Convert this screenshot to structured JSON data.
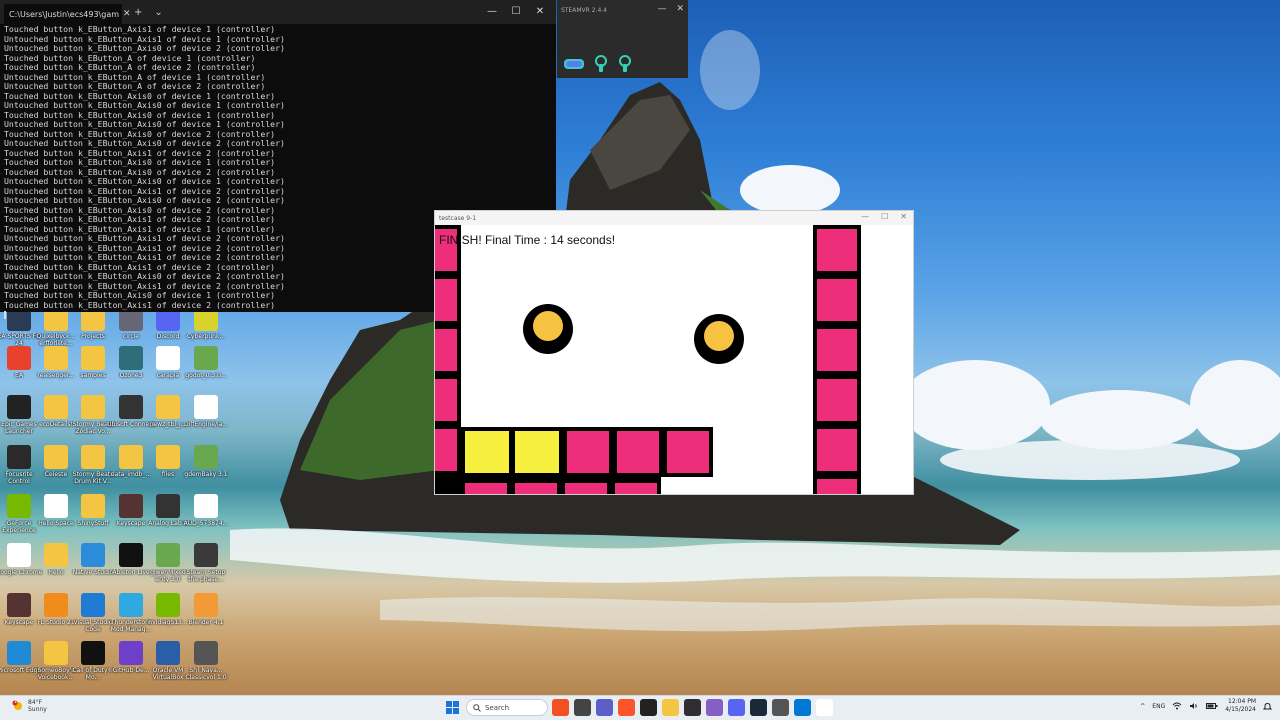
{
  "terminal": {
    "tab_title": "C:\\Users\\Justin\\ecs493\\gam",
    "new_tab_label": "+",
    "dropdown_label": "⌄",
    "minimize_label": "—",
    "maximize_label": "☐",
    "close_label": "✕",
    "lines": [
      "Touched button k_EButton_Axis1 of device 1 (controller)",
      "Untouched button k_EButton_Axis1 of device 1 (controller)",
      "Untouched button k_EButton_Axis0 of device 2 (controller)",
      "Touched button k_EButton_A of device 1 (controller)",
      "Touched button k_EButton_A of device 2 (controller)",
      "Untouched button k_EButton_A of device 1 (controller)",
      "Untouched button k_EButton_A of device 2 (controller)",
      "Touched button k_EButton_Axis0 of device 1 (controller)",
      "Untouched button k_EButton_Axis0 of device 1 (controller)",
      "Touched button k_EButton_Axis0 of device 1 (controller)",
      "Untouched button k_EButton_Axis0 of device 1 (controller)",
      "Touched button k_EButton_Axis0 of device 2 (controller)",
      "Untouched button k_EButton_Axis0 of device 2 (controller)",
      "Touched button k_EButton_Axis1 of device 2 (controller)",
      "Touched button k_EButton_Axis0 of device 1 (controller)",
      "Touched button k_EButton_Axis0 of device 2 (controller)",
      "Untouched button k_EButton_Axis0 of device 1 (controller)",
      "Untouched button k_EButton_Axis1 of device 2 (controller)",
      "Untouched button k_EButton_Axis0 of device 2 (controller)",
      "Touched button k_EButton_Axis0 of device 2 (controller)",
      "Touched button k_EButton_Axis1 of device 2 (controller)",
      "Touched button k_EButton_Axis1 of device 1 (controller)",
      "Untouched button k_EButton_Axis1 of device 2 (controller)",
      "Untouched button k_EButton_Axis1 of device 2 (controller)",
      "Untouched button k_EButton_Axis1 of device 2 (controller)",
      "Touched button k_EButton_Axis1 of device 2 (controller)",
      "Untouched button k_EButton_Axis0 of device 2 (controller)",
      "Untouched button k_EButton_Axis1 of device 2 (controller)",
      "Touched button k_EButton_Axis0 of device 1 (controller)",
      "Touched button k_EButton_Axis1 of device 2 (controller)"
    ]
  },
  "steamvr": {
    "title": "STEAMVR 2.4.4",
    "minimize_label": "—",
    "close_label": "✕"
  },
  "game": {
    "window_title": "testcase 9-1",
    "minimize_label": "—",
    "maximize_label": "☐",
    "close_label": "✕",
    "finish_text": "FINISH! Final Time : 14 seconds!"
  },
  "colors": {
    "block_pink": "#ee2e7a",
    "block_yellow": "#f6ef3e",
    "coin_gold": "#f5c242",
    "outline_black": "#000000"
  },
  "desktop_icons": [
    {
      "label": "EA SPORTS FC 24",
      "icon": "ea-sports-icon",
      "color": "#2b3a55"
    },
    {
      "label": "Quixelbyck... erfforlilte...",
      "icon": "folder-icon",
      "color": "#f4c542"
    },
    {
      "label": "Projects",
      "icon": "folder-icon",
      "color": "#f4c542"
    },
    {
      "label": "circle",
      "icon": "app-icon",
      "color": "#667"
    },
    {
      "label": "Discord",
      "icon": "discord-icon",
      "color": "#5865f2"
    },
    {
      "label": "Cyberpunk...",
      "icon": "cyberpunk-icon",
      "color": "#d8d22c"
    },
    {
      "label": "EA",
      "icon": "ea-icon",
      "color": "#e8422f"
    },
    {
      "label": "realsenger...",
      "icon": "folder-icon",
      "color": "#f4c542"
    },
    {
      "label": "samples",
      "icon": "folder-icon",
      "color": "#f4c542"
    },
    {
      "label": "Ozone3",
      "icon": "globe-icon",
      "color": "#2e6d7a"
    },
    {
      "label": "carapia",
      "icon": "media-icon",
      "color": "#ffffff"
    },
    {
      "label": "godot_0.3.0...",
      "icon": "godot-icon",
      "color": "#6aa84f"
    },
    {
      "label": "Epic Games Launcher",
      "icon": "epic-games-icon",
      "color": "#222222"
    },
    {
      "label": "ecoDetails!",
      "icon": "folder-icon",
      "color": "#f4c542"
    },
    {
      "label": "Stormy Beats Zodiac Vo...",
      "icon": "folder-icon",
      "color": "#f4c542"
    },
    {
      "label": "Ubisoft Connect",
      "icon": "ubisoft-icon",
      "color": "#333333"
    },
    {
      "label": "newz_tbl_j...",
      "icon": "zip-icon",
      "color": "#f4c542"
    },
    {
      "label": "DiffEngine/la...",
      "icon": "document-icon",
      "color": "#ffffff"
    },
    {
      "label": "Focusrite Control",
      "icon": "focusrite-icon",
      "color": "#2a2a2a"
    },
    {
      "label": "Celeste",
      "icon": "folder-icon",
      "color": "#f4c542"
    },
    {
      "label": "Stormy Beats Drum Kit V...",
      "icon": "folder-icon",
      "color": "#f4c542"
    },
    {
      "label": "data_imdb_...",
      "icon": "folder-icon",
      "color": "#f4c542"
    },
    {
      "label": "files",
      "icon": "folder-icon",
      "color": "#f4c542"
    },
    {
      "label": "gdemBaky 3.1",
      "icon": "godot-icon",
      "color": "#6aa84f"
    },
    {
      "label": "GeForce Experience",
      "icon": "nvidia-icon",
      "color": "#76b900"
    },
    {
      "label": "Hello Space",
      "icon": "media-icon",
      "color": "#ffffff"
    },
    {
      "label": "ShinyStuff",
      "icon": "folder-icon",
      "color": "#f4c542"
    },
    {
      "label": "Keyscape",
      "icon": "keyscape-icon",
      "color": "#553333"
    },
    {
      "label": "Analog Lab V",
      "icon": "analog-lab-icon",
      "color": "#333333"
    },
    {
      "label": "AUD_573874...",
      "icon": "document-icon",
      "color": "#ffffff"
    },
    {
      "label": "Google Chrome",
      "icon": "chrome-icon",
      "color": "#ffffff"
    },
    {
      "label": "Hello",
      "icon": "folder-icon",
      "color": "#f4c542"
    },
    {
      "label": "Native Studio",
      "icon": "app-icon",
      "color": "#2d8cd9"
    },
    {
      "label": "Ableton Live",
      "icon": "ableton-icon",
      "color": "#111111"
    },
    {
      "label": "gjwenMixed arity 3.0",
      "icon": "godot-icon",
      "color": "#6aa84f"
    },
    {
      "label": "Steam Setup the phase...",
      "icon": "steam-icon",
      "color": "#3a3a3a"
    },
    {
      "label": "Keyscape",
      "icon": "keyscape-icon",
      "color": "#553333"
    },
    {
      "label": "FL Studio 21",
      "icon": "fl-studio-icon",
      "color": "#f08c1b"
    },
    {
      "label": "Visual Studio Code",
      "icon": "vscode-icon",
      "color": "#1f7bd4"
    },
    {
      "label": "Thunderstore Mod Manag...",
      "icon": "thunderstore-icon",
      "color": "#2fa9e0"
    },
    {
      "label": "nvidiagS13...",
      "icon": "nvidia-icon",
      "color": "#76b900"
    },
    {
      "label": "Blender 4.1",
      "icon": "blender-icon",
      "color": "#f29a38"
    },
    {
      "label": "Microsoft Edge",
      "icon": "edge-icon",
      "color": "#1f8ad6"
    },
    {
      "label": "SomeoBoy's Voicebook...",
      "icon": "folder-icon",
      "color": "#f4c542"
    },
    {
      "label": "Call of Duty® Mo...",
      "icon": "cod-icon",
      "color": "#111111"
    },
    {
      "label": "GitHub De...",
      "icon": "github-icon",
      "color": "#6e40c9"
    },
    {
      "label": "Oracle VM VirtualBox",
      "icon": "virtualbox-icon",
      "color": "#2a5fa8"
    },
    {
      "label": "Sh! Nava... Classicvol 1.0",
      "icon": "yi-icon",
      "color": "#555555"
    }
  ],
  "taskbar": {
    "weather_temp": "84°F",
    "weather_desc": "Sunny",
    "weather_badge": "1",
    "search_placeholder": "Search",
    "apps": [
      {
        "icon": "shell-icon",
        "color": "#f25022"
      },
      {
        "icon": "task-view-icon",
        "color": "#444444"
      },
      {
        "icon": "teams-icon",
        "color": "#5b5fc7"
      },
      {
        "icon": "brave-icon",
        "color": "#fb542b"
      },
      {
        "icon": "terminal-icon",
        "color": "#222222"
      },
      {
        "icon": "file-explorer-icon",
        "color": "#f4c542"
      },
      {
        "icon": "obs-icon",
        "color": "#302e31"
      },
      {
        "icon": "visual-studio-icon",
        "color": "#865fc5"
      },
      {
        "icon": "discord-icon",
        "color": "#5865f2"
      },
      {
        "icon": "steam-icon",
        "color": "#1b2838"
      },
      {
        "icon": "app-icon",
        "color": "#555555"
      },
      {
        "icon": "settings-icon",
        "color": "#0078d4"
      },
      {
        "icon": "chrome-icon",
        "color": "#ffffff"
      }
    ],
    "tray_chevron": "^",
    "language": "ENG",
    "time": "12:04 PM",
    "date": "4/15/2024"
  }
}
